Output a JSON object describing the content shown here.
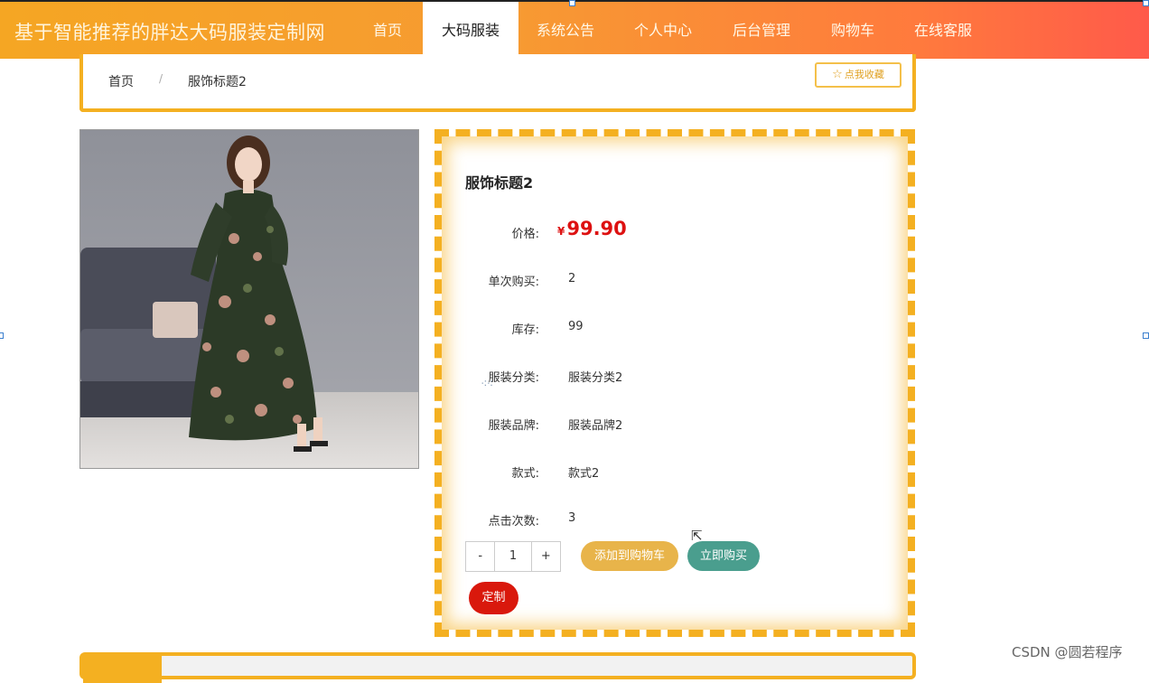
{
  "header": {
    "site_title": "基于智能推荐的胖达大码服装定制网",
    "nav": [
      {
        "label": "首页",
        "active": false
      },
      {
        "label": "大码服装",
        "active": true
      },
      {
        "label": "系统公告",
        "active": false
      },
      {
        "label": "个人中心",
        "active": false
      },
      {
        "label": "后台管理",
        "active": false
      },
      {
        "label": "购物车",
        "active": false
      },
      {
        "label": "在线客服",
        "active": false
      }
    ]
  },
  "breadcrumb": {
    "home": "首页",
    "separator": "/",
    "current": "服饰标题2",
    "favorite_button": "点我收藏",
    "favorite_icon": "star-icon"
  },
  "product": {
    "title": "服饰标题2",
    "image_alt": "floral long dress product photo",
    "price_label": "价格:",
    "currency": "¥",
    "price": "99.90",
    "rows": [
      {
        "label": "单次购买:",
        "value": "2"
      },
      {
        "label": "库存:",
        "value": "99"
      },
      {
        "label": "服装分类:",
        "value": "服装分类2"
      },
      {
        "label": "服装品牌:",
        "value": "服装品牌2"
      },
      {
        "label": "款式:",
        "value": "款式2"
      },
      {
        "label": "点击次数:",
        "value": "3"
      }
    ],
    "quantity": {
      "minus": "-",
      "value": "1",
      "plus": "+"
    },
    "buttons": {
      "add_to_cart": "添加到购物车",
      "buy_now": "立即购买",
      "customize": "定制"
    }
  },
  "watermark": "CSDN @圆若程序",
  "colors": {
    "accent": "#f4b021",
    "price": "#dd1111",
    "buy": "#4a9e8e",
    "cart": "#e8b44a",
    "customize": "#d9180c"
  }
}
